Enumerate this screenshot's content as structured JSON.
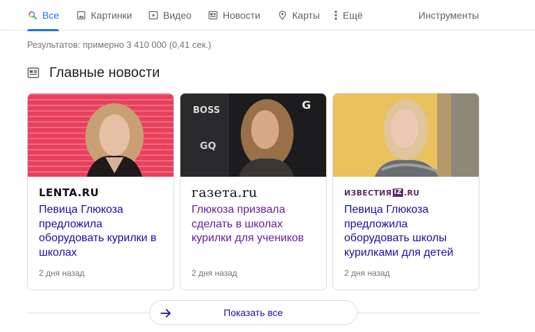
{
  "tabs": [
    {
      "label": "Все",
      "icon": "search-icon",
      "active": true
    },
    {
      "label": "Картинки",
      "icon": "image-icon"
    },
    {
      "label": "Видео",
      "icon": "video-icon"
    },
    {
      "label": "Новости",
      "icon": "news-icon"
    },
    {
      "label": "Карты",
      "icon": "map-pin-icon"
    },
    {
      "label": "Ещё",
      "icon": "more-vertical-icon"
    }
  ],
  "tools_label": "Инструменты",
  "stats": "Результатов: примерно 3 410 000 (0,41 сек.)",
  "top_stories": {
    "title": "Главные новости",
    "icon": "news-icon"
  },
  "cards": [
    {
      "source": "LENTA.RU",
      "headline": "Певица Глюкоза предложила оборудовать курилки в школах",
      "time": "2 дня назад"
    },
    {
      "source": "газета.ru",
      "headline": "Глюкоза призвала сделать в школах курилки для учеников",
      "time": "2 дня назад",
      "visited": true
    },
    {
      "source_parts": [
        "ИЗВЕСТИЯ",
        "IZ",
        ".RU"
      ],
      "headline": "Певица Глюкоза предложила оборудовать школы курилками для детей",
      "time": "2 дня назад"
    }
  ],
  "show_all_label": "Показать все",
  "colors": {
    "accent": "#1a73e8",
    "link": "#1a0dab",
    "visited": "#681da8",
    "muted": "#70757a",
    "border": "#dadce0"
  }
}
